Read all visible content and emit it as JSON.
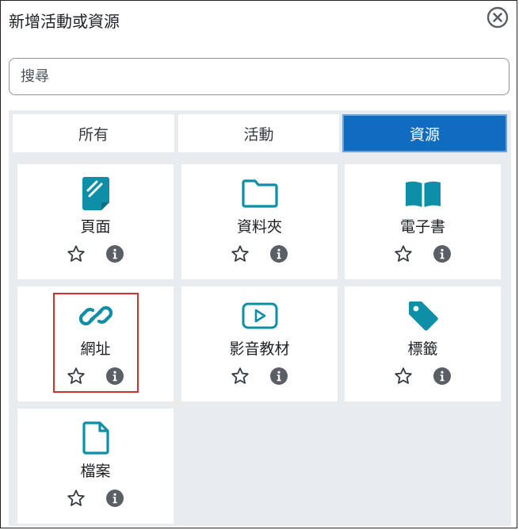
{
  "dialog": {
    "title": "新增活動或資源",
    "close_icon": "close-circle-icon"
  },
  "search": {
    "placeholder": "搜尋"
  },
  "tabs": [
    {
      "label": "所有",
      "active": false
    },
    {
      "label": "活動",
      "active": false
    },
    {
      "label": "資源",
      "active": true
    }
  ],
  "items": [
    {
      "name": "頁面",
      "icon": "page-icon"
    },
    {
      "name": "資料夾",
      "icon": "folder-icon"
    },
    {
      "name": "電子書",
      "icon": "book-icon"
    },
    {
      "name": "網址",
      "icon": "link-icon",
      "highlighted": true
    },
    {
      "name": "影音教材",
      "icon": "video-icon"
    },
    {
      "name": "標籤",
      "icon": "tag-icon"
    },
    {
      "name": "檔案",
      "icon": "file-icon"
    }
  ],
  "colors": {
    "accent": "#0f6cbf",
    "icon_teal": "#0d8fa8",
    "panel_bg": "#e9ecef",
    "highlight": "#d32f2f",
    "info_gray": "#5a5f65"
  }
}
